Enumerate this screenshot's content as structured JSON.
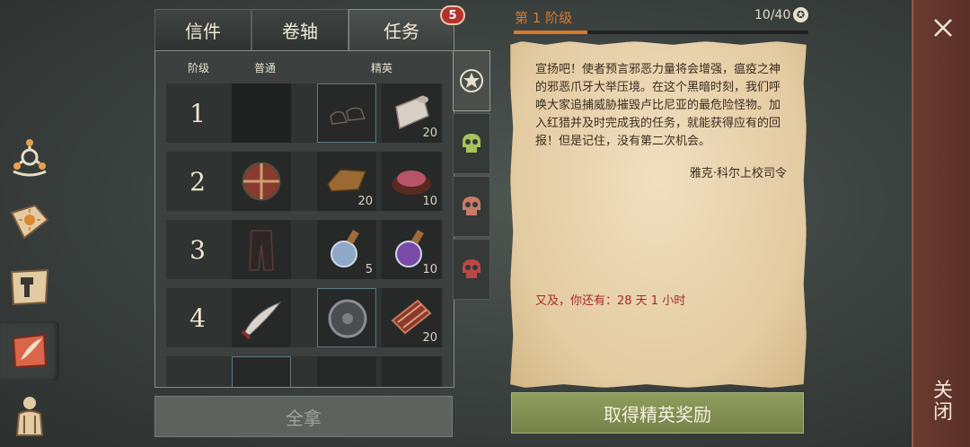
{
  "tabs": [
    {
      "label": "信件"
    },
    {
      "label": "卷轴"
    },
    {
      "label": "任务"
    }
  ],
  "task_badge": "5",
  "columns": {
    "rank": "阶级",
    "normal": "普通",
    "elite": "精英"
  },
  "rows": [
    {
      "rank": "1",
      "slots": [
        {
          "icon": "empty-slot",
          "count": ""
        },
        {
          "icon": "boots-icon",
          "count": ""
        },
        {
          "icon": "cloth-roll-icon",
          "count": "20"
        }
      ]
    },
    {
      "rank": "2",
      "slots": [
        {
          "icon": "round-shield-icon",
          "count": ""
        },
        {
          "icon": "ingot-icon",
          "count": "20"
        },
        {
          "icon": "meat-bowl-icon",
          "count": "10"
        }
      ]
    },
    {
      "rank": "3",
      "slots": [
        {
          "icon": "leather-pants-icon",
          "count": ""
        },
        {
          "icon": "potion-blue-icon",
          "count": "5"
        },
        {
          "icon": "potion-purple-icon",
          "count": "10"
        }
      ]
    },
    {
      "rank": "4",
      "slots": [
        {
          "icon": "scimitar-icon",
          "count": ""
        },
        {
          "icon": "buckler-icon",
          "count": ""
        },
        {
          "icon": "bacon-icon",
          "count": "20"
        }
      ]
    }
  ],
  "take_all_label": "全拿",
  "stage": {
    "label": "第 1 阶级",
    "progress_text": "10/40",
    "progress": 0.25,
    "icon": "coin-icon"
  },
  "letter": {
    "body": "宣扬吧！使者预言邪恶力量将会增强，瘟疫之神的邪恶爪牙大举压境。在这个黑暗时刻，我们呼唤大家追捕威胁摧毁卢比尼亚的最危险怪物。加入红猎并及时完成我的任务，就能获得应有的回报！但是记住，没有第二次机会。",
    "signature": "雅克·科尔上校司令",
    "remaining": "又及，你还有：28 天 1 小时"
  },
  "claim_label": "取得精英奖励",
  "close_label": "关闭",
  "colors": {
    "accent": "#d87a2e",
    "claim": "#85934f",
    "remaining": "#a8292a"
  }
}
